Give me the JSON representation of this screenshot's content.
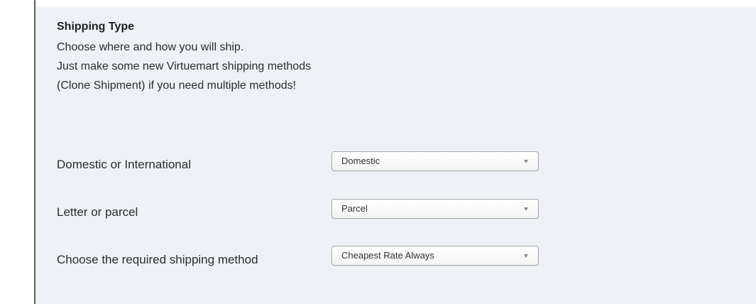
{
  "section": {
    "title": "Shipping Type",
    "description_lines": [
      "Choose where and how you will ship.",
      "Just make some new Virtuemart shipping methods",
      "(Clone Shipment) if you need multiple methods!"
    ]
  },
  "fields": [
    {
      "label": "Domestic or International",
      "selected": "Domestic"
    },
    {
      "label": "Letter or parcel",
      "selected": "Parcel"
    },
    {
      "label": "Choose the required shipping method",
      "selected": "Cheapest Rate Always"
    }
  ]
}
